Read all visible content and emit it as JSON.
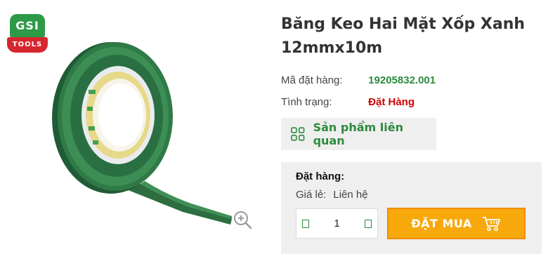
{
  "logo": {
    "top_text": "GSI",
    "bottom_text": "TOOLS"
  },
  "product": {
    "title": "Băng Keo Hai Mặt Xốp Xanh 12mmx10m",
    "code_label": "Mã đặt hàng:",
    "code_value": "19205832.001",
    "status_label": "Tình trạng:",
    "status_value": "Đặt Hàng"
  },
  "related": {
    "label": "Sản phẩm liên quan",
    "icon": "grid-icon"
  },
  "order": {
    "title": "Đặt hàng:",
    "price_label": "Giá lẻ:",
    "price_value": "Liên hệ",
    "quantity": "1",
    "buy_label": "ĐẶT MUA",
    "buy_icon": "cart-icon"
  },
  "colors": {
    "green": "#2d8a3e",
    "red": "#d20000",
    "orange": "#f7a90c",
    "tape_green": "#2f7a46",
    "panel_gray": "#efefef"
  }
}
